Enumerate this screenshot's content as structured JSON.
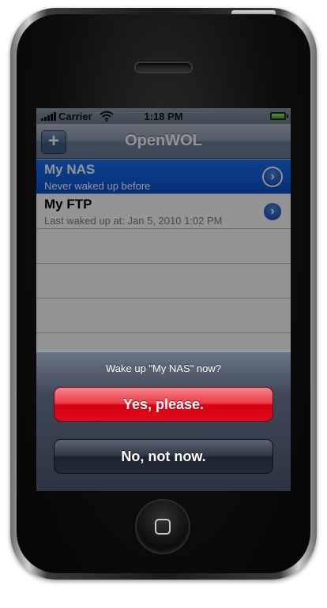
{
  "status_bar": {
    "carrier": "Carrier",
    "time": "1:18 PM"
  },
  "nav": {
    "title": "OpenWOL",
    "add_label": "+"
  },
  "devices": [
    {
      "name": "My NAS",
      "status": "Never waked up before",
      "selected": true
    },
    {
      "name": "My FTP",
      "status": "Last waked up at: Jan 5, 2010 1:02 PM",
      "selected": false
    }
  ],
  "action_sheet": {
    "title": "Wake up \"My NAS\" now?",
    "confirm_label": "Yes, please.",
    "cancel_label": "No, not now."
  },
  "icons": {
    "disclosure": "chevron-right-icon",
    "signal": "signal-bars-icon",
    "wifi": "wifi-icon",
    "battery": "battery-icon",
    "home": "home-square-icon"
  },
  "colors": {
    "selection_blue": "#0a52d3",
    "destructive_red": "#d60012",
    "nav_bar": "#6e829a"
  }
}
